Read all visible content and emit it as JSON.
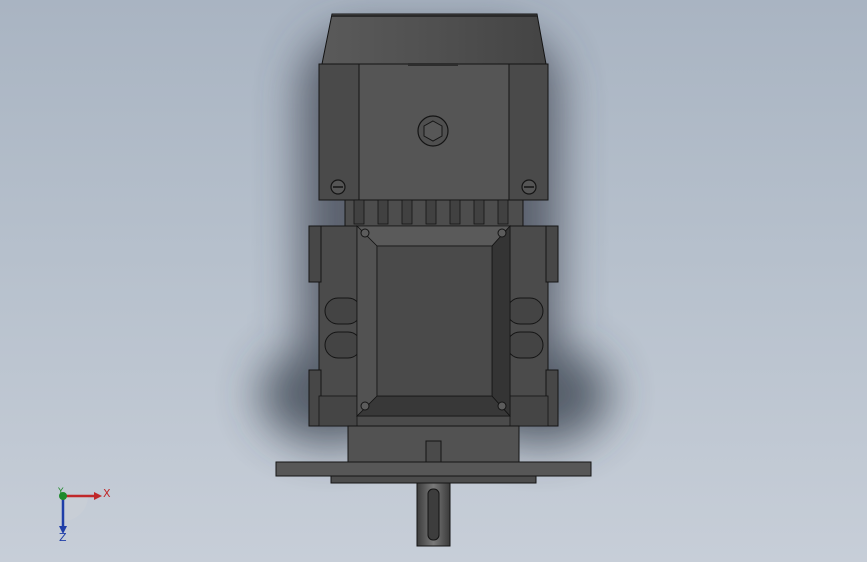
{
  "viewport": {
    "model": "gear-motor-front-view",
    "colors": {
      "background_top": "#a9b4c2",
      "background_bottom": "#c7ced8",
      "body": "#4e4e4e",
      "body_light": "#5f5f5f",
      "body_dark": "#393939",
      "edge": "#141414",
      "shadow": "#3c4350"
    }
  },
  "triad": {
    "x_label": "X",
    "y_label": "Y",
    "z_label": "Z",
    "colors": {
      "x": "#c0282a",
      "y": "#1f8a2c",
      "z": "#1f3ea8"
    }
  }
}
